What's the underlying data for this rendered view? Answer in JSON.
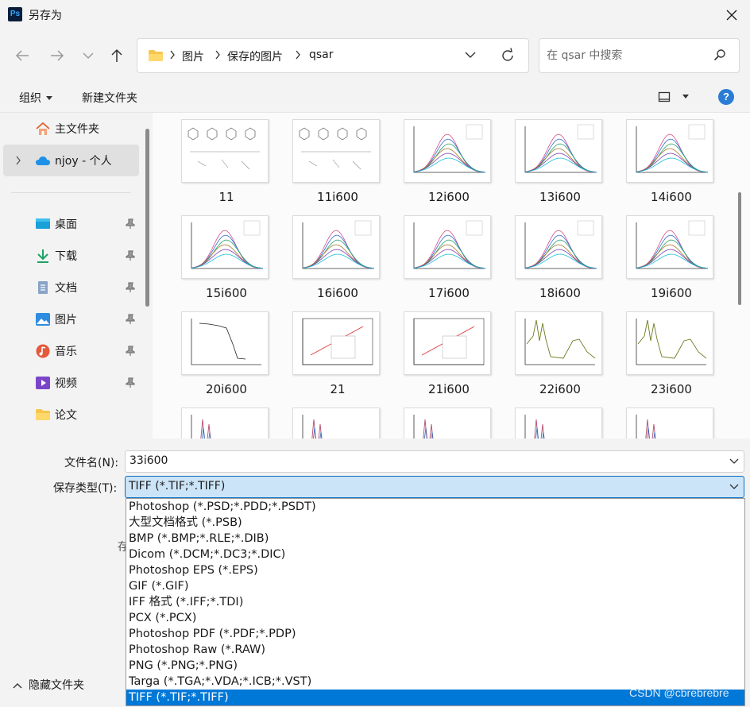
{
  "window": {
    "title": "另存为",
    "app_icon_text": "Ps"
  },
  "nav": {
    "breadcrumbs": [
      "图片",
      "保存的图片",
      "qsar"
    ],
    "search_placeholder": "在 qsar 中搜索"
  },
  "toolbar": {
    "organize_label": "组织",
    "new_folder_label": "新建文件夹",
    "help_label": "?"
  },
  "sidebar": {
    "quick": [
      {
        "label": "主文件夹",
        "icon": "home-icon"
      },
      {
        "label": "njoy - 个人",
        "icon": "onedrive-cloud-icon",
        "selected": true
      }
    ],
    "pinned": [
      {
        "label": "桌面",
        "icon": "desktop-icon"
      },
      {
        "label": "下载",
        "icon": "download-icon"
      },
      {
        "label": "文档",
        "icon": "documents-icon"
      },
      {
        "label": "图片",
        "icon": "pictures-icon"
      },
      {
        "label": "音乐",
        "icon": "music-icon"
      },
      {
        "label": "视频",
        "icon": "videos-icon"
      }
    ],
    "extra": {
      "label": "论文",
      "icon": "folder-icon"
    }
  },
  "files": [
    {
      "name": "11",
      "kind": "structure"
    },
    {
      "name": "11i600",
      "kind": "structure"
    },
    {
      "name": "12i600",
      "kind": "spectrum",
      "tag": "c"
    },
    {
      "name": "13i600",
      "kind": "spectrum",
      "tag": "d"
    },
    {
      "name": "14i600",
      "kind": "spectrum",
      "tag": "e"
    },
    {
      "name": "15i600",
      "kind": "spectrum",
      "tag": "a"
    },
    {
      "name": "16i600",
      "kind": "spectrum",
      "tag": "b"
    },
    {
      "name": "17i600",
      "kind": "spectrum",
      "tag": "c"
    },
    {
      "name": "18i600",
      "kind": "spectrum",
      "tag": "d"
    },
    {
      "name": "19i600",
      "kind": "spectrum",
      "tag": "e"
    },
    {
      "name": "20i600",
      "kind": "decay",
      "tag": "a"
    },
    {
      "name": "21",
      "kind": "linear",
      "tag": "b"
    },
    {
      "name": "21i600",
      "kind": "linear",
      "tag": "b"
    },
    {
      "name": "22i600",
      "kind": "absorb"
    },
    {
      "name": "23i600",
      "kind": "absorb"
    },
    {
      "name": "",
      "kind": "peaks"
    },
    {
      "name": "",
      "kind": "peaks"
    },
    {
      "name": "",
      "kind": "peaks"
    },
    {
      "name": "",
      "kind": "peaks"
    },
    {
      "name": "",
      "kind": "peaks"
    }
  ],
  "form": {
    "filename_label": "文件名(N):",
    "filename_value": "33i600",
    "filetype_label": "保存类型(T):",
    "filetype_value": "TIFF (*.TIF;*.TIFF)",
    "hidden_text_fragment": "存",
    "hide_folders_label": "隐藏文件夹"
  },
  "filetype_options": [
    "Photoshop (*.PSD;*.PDD;*.PSDT)",
    "大型文档格式 (*.PSB)",
    "BMP (*.BMP;*.RLE;*.DIB)",
    "Dicom (*.DCM;*.DC3;*.DIC)",
    "Photoshop EPS (*.EPS)",
    "GIF (*.GIF)",
    "IFF 格式 (*.IFF;*.TDI)",
    "PCX (*.PCX)",
    "Photoshop PDF (*.PDF;*.PDP)",
    "Photoshop Raw (*.RAW)",
    "PNG (*.PNG;*.PNG)",
    "Targa (*.TGA;*.VDA;*.ICB;*.VST)",
    "TIFF (*.TIF;*.TIFF)"
  ],
  "selected_filetype_index": 12,
  "watermark": "CSDN @cbrebrebre",
  "colors": {
    "accent": "#0078d7",
    "selection_bg": "#cce4f7",
    "chrome_bg": "#f3f3f3"
  }
}
